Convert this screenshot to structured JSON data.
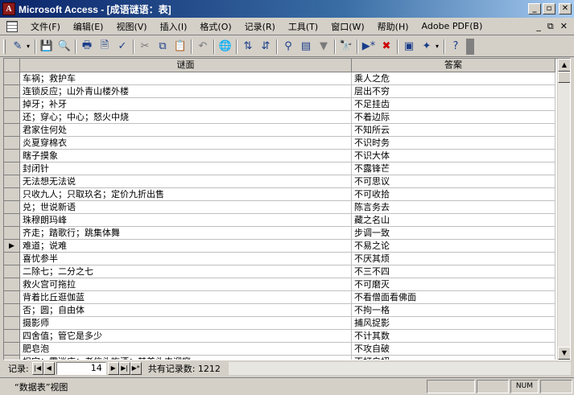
{
  "window": {
    "title": "Microsoft Access - [成语谜语：表]",
    "app_icon": "access-logo"
  },
  "menu": {
    "items": [
      "文件(F)",
      "编辑(E)",
      "视图(V)",
      "插入(I)",
      "格式(O)",
      "记录(R)",
      "工具(T)",
      "窗口(W)",
      "帮助(H)",
      "Adobe PDF(B)"
    ],
    "right": [
      "_",
      "⧉",
      "✕"
    ]
  },
  "table": {
    "columns": [
      "谜面",
      "答案"
    ],
    "rows": [
      [
        "车祸；救护车",
        "乘人之危"
      ],
      [
        "连锁反应；山外青山楼外楼",
        "层出不穷"
      ],
      [
        "掉牙；补牙",
        "不足挂齿"
      ],
      [
        "还；穿心；中心；怒火中烧",
        "不着边际"
      ],
      [
        "君家住何处",
        "不知所云"
      ],
      [
        "炎夏穿棉衣",
        "不识时务"
      ],
      [
        "瞎子摸象",
        "不识大体"
      ],
      [
        "封闭针",
        "不露锋芒"
      ],
      [
        "无法想无法说",
        "不可思议"
      ],
      [
        "只收九人；只取玖名；定价九折出售",
        "不可收拾"
      ],
      [
        "兑；世说新语",
        "陈言务去"
      ],
      [
        "珠穆朗玛峰",
        "藏之名山"
      ],
      [
        "齐走；踏歌行；跳集体舞",
        "步调一致"
      ],
      [
        "难道；说难",
        "不易之论"
      ],
      [
        "喜忧参半",
        "不厌其烦"
      ],
      [
        "二除七；二分之七",
        "不三不四"
      ],
      [
        "救火宫可拖拉",
        "不可磨灭"
      ],
      [
        "背着比丘逛伽蓝",
        "不看僧面看佛面"
      ],
      [
        "否；圆；自由体",
        "不拘一格"
      ],
      [
        "摄影师",
        "捕风捉影"
      ],
      [
        "四舍值；管它是多少",
        "不计其数"
      ],
      [
        "肥皂泡",
        "不攻自破"
      ],
      [
        "担字；霜迷店；老信头吃酒；其美头丰迎庭",
        "不打自招"
      ]
    ],
    "current_row": 13
  },
  "nav": {
    "label": "记录:",
    "current": "14",
    "count_text": "共有记录数: 1212"
  },
  "status": {
    "text": "“数据表”视图",
    "num": "NUM"
  }
}
